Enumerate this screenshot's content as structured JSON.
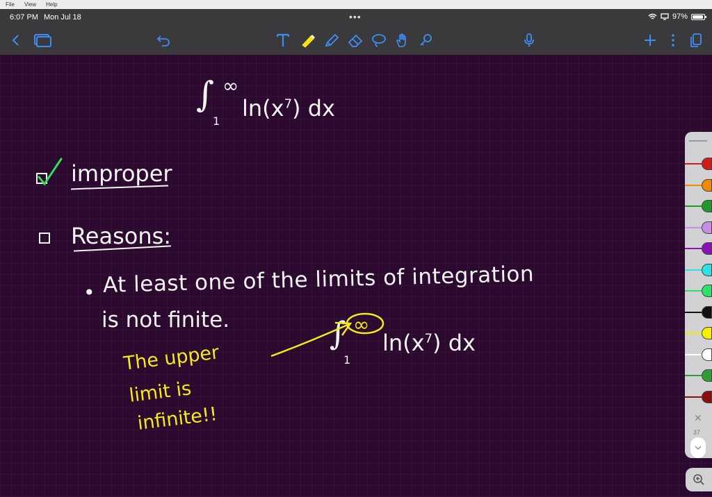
{
  "menubar": {
    "items": [
      "File",
      "View",
      "Help"
    ]
  },
  "status": {
    "time": "6:07 PM",
    "date": "Mon Jul 18",
    "more": "•••",
    "battery": "97%"
  },
  "toolbar": {
    "icons": [
      "back-icon",
      "pages-icon",
      "undo-icon",
      "text-tool-icon",
      "highlighter-icon",
      "pen-icon",
      "eraser-icon",
      "lasso-icon",
      "hand-icon",
      "link-icon",
      "mic-icon",
      "add-icon",
      "more-icon",
      "copy-icon"
    ]
  },
  "notes": {
    "formula_top": {
      "lower": "1",
      "upper": "∞",
      "body": "ln(x",
      "exp": "7",
      "tail": ") dx"
    },
    "item1": "improper",
    "item2": "Reasons:",
    "bullet": "•",
    "line1": "At least one of the limits of integration",
    "line2": "is not finite.",
    "formula_bottom": {
      "lower": "1",
      "upper": "∞",
      "body": "ln(x",
      "exp": "7",
      "tail": ") dx"
    },
    "annotation": [
      "The upper",
      "limit is",
      "infinite!!"
    ]
  },
  "palette": {
    "page_number": "37",
    "pens": [
      "#d11a1a",
      "#f08a00",
      "#1f9a2a",
      "#c98ee6",
      "#8a12b5",
      "#2ee0e0",
      "#2fe06a",
      "#111111",
      "#f5f000",
      "#ffffff",
      "#2e9a38",
      "#8a1010"
    ]
  },
  "colors": {
    "canvas": "#2c0a2f",
    "ink_white": "#f4f4f4",
    "ink_yellow": "#f2ea1a",
    "check_green": "#2ee05a"
  }
}
